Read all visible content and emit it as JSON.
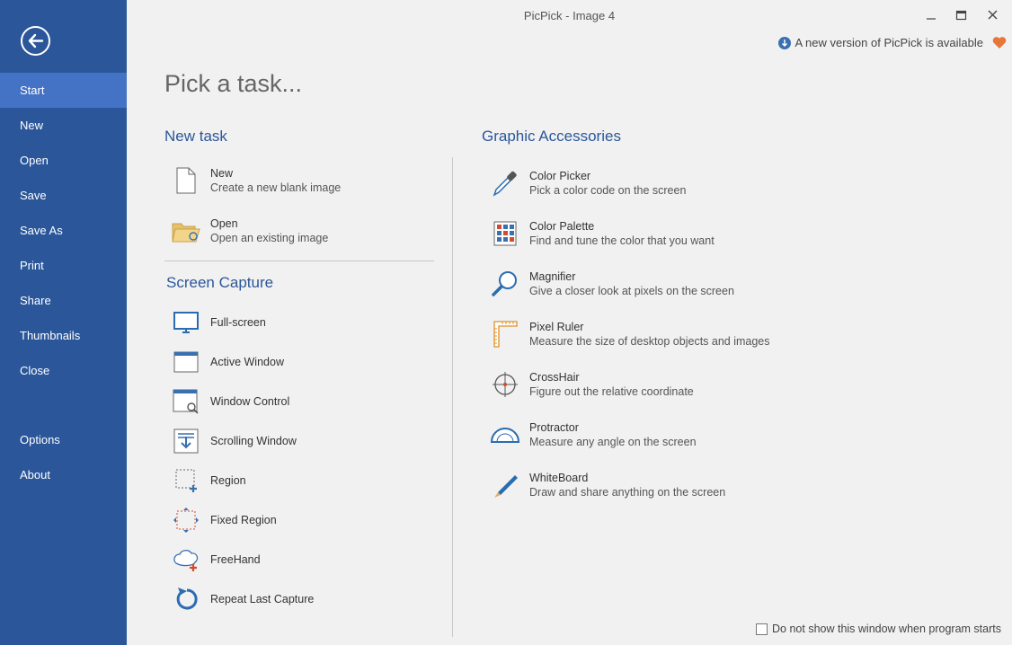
{
  "window": {
    "title": "PicPick - Image 4"
  },
  "update_notice": "A new version of PicPick is available",
  "sidebar": {
    "items": [
      {
        "label": "Start"
      },
      {
        "label": "New"
      },
      {
        "label": "Open"
      },
      {
        "label": "Save"
      },
      {
        "label": "Save As"
      },
      {
        "label": "Print"
      },
      {
        "label": "Share"
      },
      {
        "label": "Thumbnails"
      },
      {
        "label": "Close"
      },
      {
        "label": "Options"
      },
      {
        "label": "About"
      }
    ]
  },
  "main": {
    "title": "Pick a task...",
    "new_task": {
      "title": "New task",
      "items": [
        {
          "label": "New",
          "desc": "Create a new blank image"
        },
        {
          "label": "Open",
          "desc": "Open an existing image"
        }
      ]
    },
    "screen_capture": {
      "title": "Screen Capture",
      "items": [
        {
          "label": "Full-screen"
        },
        {
          "label": "Active Window"
        },
        {
          "label": "Window Control"
        },
        {
          "label": "Scrolling Window"
        },
        {
          "label": "Region"
        },
        {
          "label": "Fixed Region"
        },
        {
          "label": "FreeHand"
        },
        {
          "label": "Repeat Last Capture"
        }
      ]
    },
    "graphic_accessories": {
      "title": "Graphic Accessories",
      "items": [
        {
          "label": "Color Picker",
          "desc": "Pick a color code on the screen"
        },
        {
          "label": "Color Palette",
          "desc": "Find and tune the color that you want"
        },
        {
          "label": "Magnifier",
          "desc": "Give a closer look at pixels on the screen"
        },
        {
          "label": "Pixel Ruler",
          "desc": "Measure the size of desktop objects and images"
        },
        {
          "label": "CrossHair",
          "desc": "Figure out the relative coordinate"
        },
        {
          "label": "Protractor",
          "desc": "Measure any angle on the screen"
        },
        {
          "label": "WhiteBoard",
          "desc": "Draw and share anything on the screen"
        }
      ]
    }
  },
  "footer": {
    "checkbox_label": "Do not show this window when program starts"
  },
  "colors": {
    "sidebar": "#2b579a",
    "sidebar_active": "#4472c4",
    "accent": "#2b579a",
    "heart": "#e8753a"
  }
}
